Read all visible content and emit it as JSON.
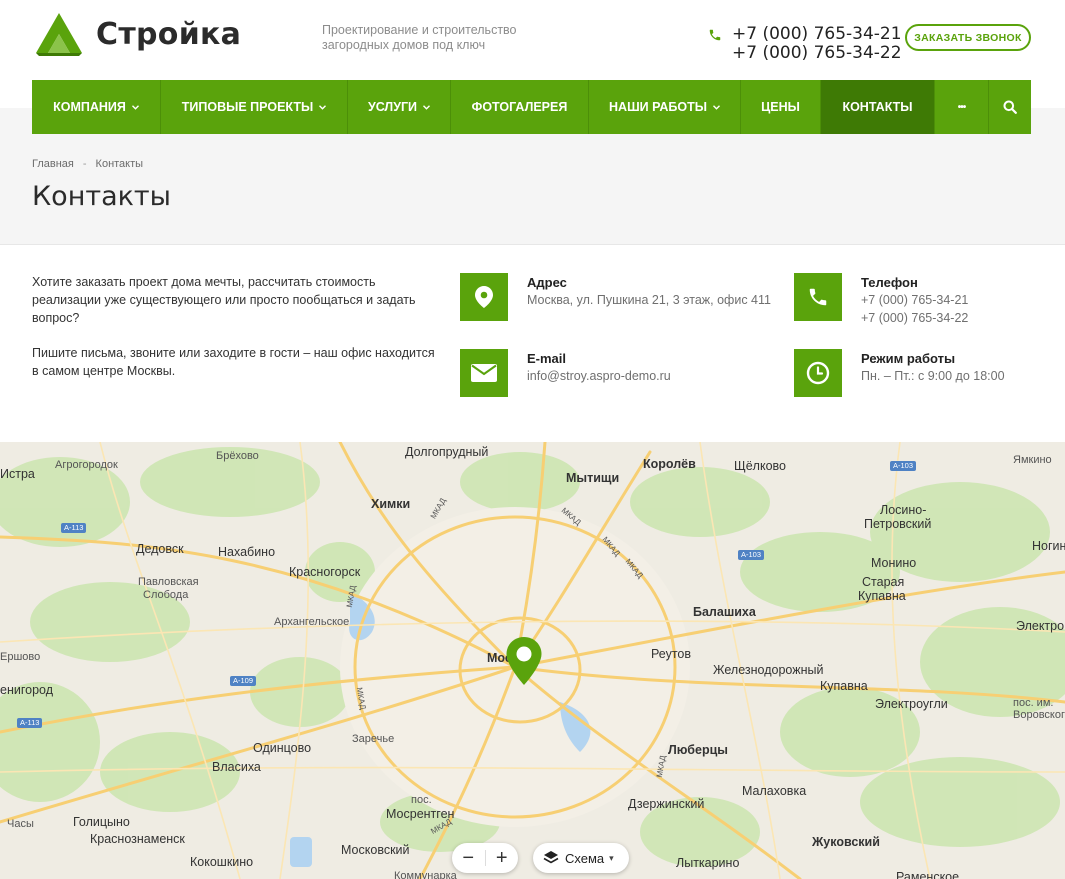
{
  "header": {
    "logo_text": "Стройка",
    "slogan": "Проектирование и строительство загородных домов под ключ",
    "phones": [
      "+7 (000) 765-34-21",
      "+7 (000) 765-34-22"
    ],
    "callback_label": "Заказать звонок"
  },
  "nav": {
    "items": [
      {
        "label": "Компания",
        "has_dropdown": true
      },
      {
        "label": "Типовые проекты",
        "has_dropdown": true
      },
      {
        "label": "Услуги",
        "has_dropdown": true
      },
      {
        "label": "Фотогалерея",
        "has_dropdown": false
      },
      {
        "label": "Наши работы",
        "has_dropdown": true
      },
      {
        "label": "Цены",
        "has_dropdown": false
      },
      {
        "label": "Контакты",
        "has_dropdown": false,
        "active": true
      }
    ],
    "more_label": "•••",
    "accent": "#5aa30c",
    "active_color": "#3e7a05"
  },
  "breadcrumb": {
    "home": "Главная",
    "separator": "-",
    "current": "Контакты"
  },
  "page_title": "Контакты",
  "intro": {
    "p1": "Хотите заказать проект дома мечты, рассчитать стоимость реализации уже существующего или просто пообщаться и задать вопрос?",
    "p2": "Пишите письма, звоните или заходите в гости – наш офис находится в самом центре Москвы."
  },
  "contacts": {
    "address": {
      "label": "Адрес",
      "value": "Москва, ул. Пушкина 21, 3 этаж, офис 411",
      "icon": "location-icon"
    },
    "phone": {
      "label": "Телефон",
      "values": [
        "+7 (000) 765-34-21",
        "+7 (000) 765-34-22"
      ],
      "icon": "phone-icon"
    },
    "email": {
      "label": "E-mail",
      "value": "info@stroy.aspro-demo.ru",
      "icon": "envelope-icon"
    },
    "hours": {
      "label": "Режим работы",
      "value": "Пн. – Пт.: с 9:00 до 18:00",
      "icon": "clock-icon"
    }
  },
  "map": {
    "labels": {
      "istra": "Истра",
      "agrogorodok": "Агрогородок",
      "brekhovo": "Брёхово",
      "dolgoprudny": "Долгопрудный",
      "korolev": "Королёв",
      "shchelkovo": "Щёлково",
      "yamkino": "Ямкино",
      "mytishchi": "Мытищи",
      "khimki": "Химки",
      "losino1": "Лосино-",
      "losino2": "Петровский",
      "dedovsk": "Дедовск",
      "nakhabino": "Нахабино",
      "krasnogorsk": "Красногорск",
      "monino": "Монино",
      "noginsk": "Ногин",
      "pavlovskaya1": "Павловская",
      "pavlovskaya2": "Слобода",
      "staraya1": "Старая",
      "staraya2": "Купавна",
      "balashikha": "Балашиха",
      "arkhangelskoe": "Архангельское",
      "elektro": "Электро",
      "ershovo": "Ершово",
      "moskva": "Москва",
      "reutov": "Реутов",
      "zheleznodorozhny": "Железнодорожный",
      "zvenigorod": "енигород",
      "kupavna": "Купавна",
      "elektrougli": "Электроугли",
      "vorovskogo1": "пос. им.",
      "vorovskogo2": "Воровского",
      "odintsovo": "Одинцово",
      "zarechye": "Заречье",
      "lyubertsy": "Люберцы",
      "vlasikha": "Власиха",
      "pos": "пос.",
      "mosrentgen": "Мосрентген",
      "dzerzhinsky": "Дзержинский",
      "malakhovka": "Малаховка",
      "chasy": "Часы",
      "golitsyno": "Голицыно",
      "krasnoznamensk": "Краснознаменск",
      "zhukovsky": "Жуковский",
      "kokoshkino": "Кокошкино",
      "moskovsky": "Московский",
      "lytkarino": "Лыткарино",
      "kommunarka": "Коммунарка",
      "ramenskoe": "Раменское"
    },
    "shields": {
      "a103_top": "А-103",
      "a103_mid": "А-103",
      "a113_left": "А-113",
      "a109": "А-109",
      "a113_bot": "А-113"
    },
    "road_labels": [
      "МКАД",
      "МКАД",
      "МКАД",
      "МКАД",
      "МКАД",
      "МКАД",
      "МКАД",
      "МКАД"
    ],
    "zoom_out": "−",
    "zoom_in": "+",
    "layer_label": "Схема",
    "layer_caret": "▾"
  }
}
